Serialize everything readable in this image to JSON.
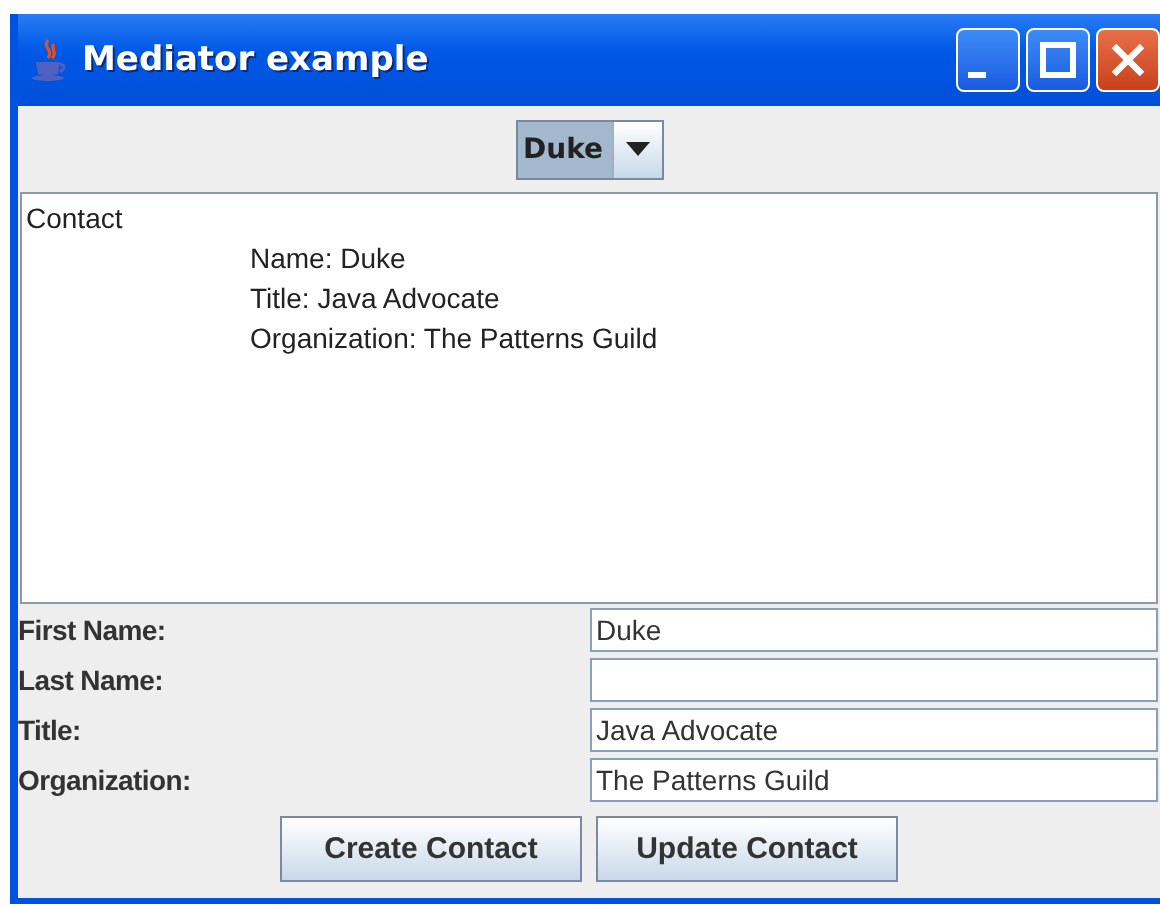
{
  "window": {
    "title": "Mediator example"
  },
  "contact_selector": {
    "value": "Duke"
  },
  "contact_area": {
    "heading": "Contact",
    "lines": [
      "Name: Duke",
      "Title: Java Advocate",
      "Organization: The Patterns Guild"
    ]
  },
  "fields": [
    {
      "label": "First Name:",
      "value": "Duke"
    },
    {
      "label": "Last Name:"
    },
    {
      "label": "Title:",
      "value": "Java Advocate"
    },
    {
      "label": "Organization:",
      "value": "The Patterns Guild"
    }
  ],
  "buttons": [
    "Create Contact",
    "Update Contact"
  ]
}
